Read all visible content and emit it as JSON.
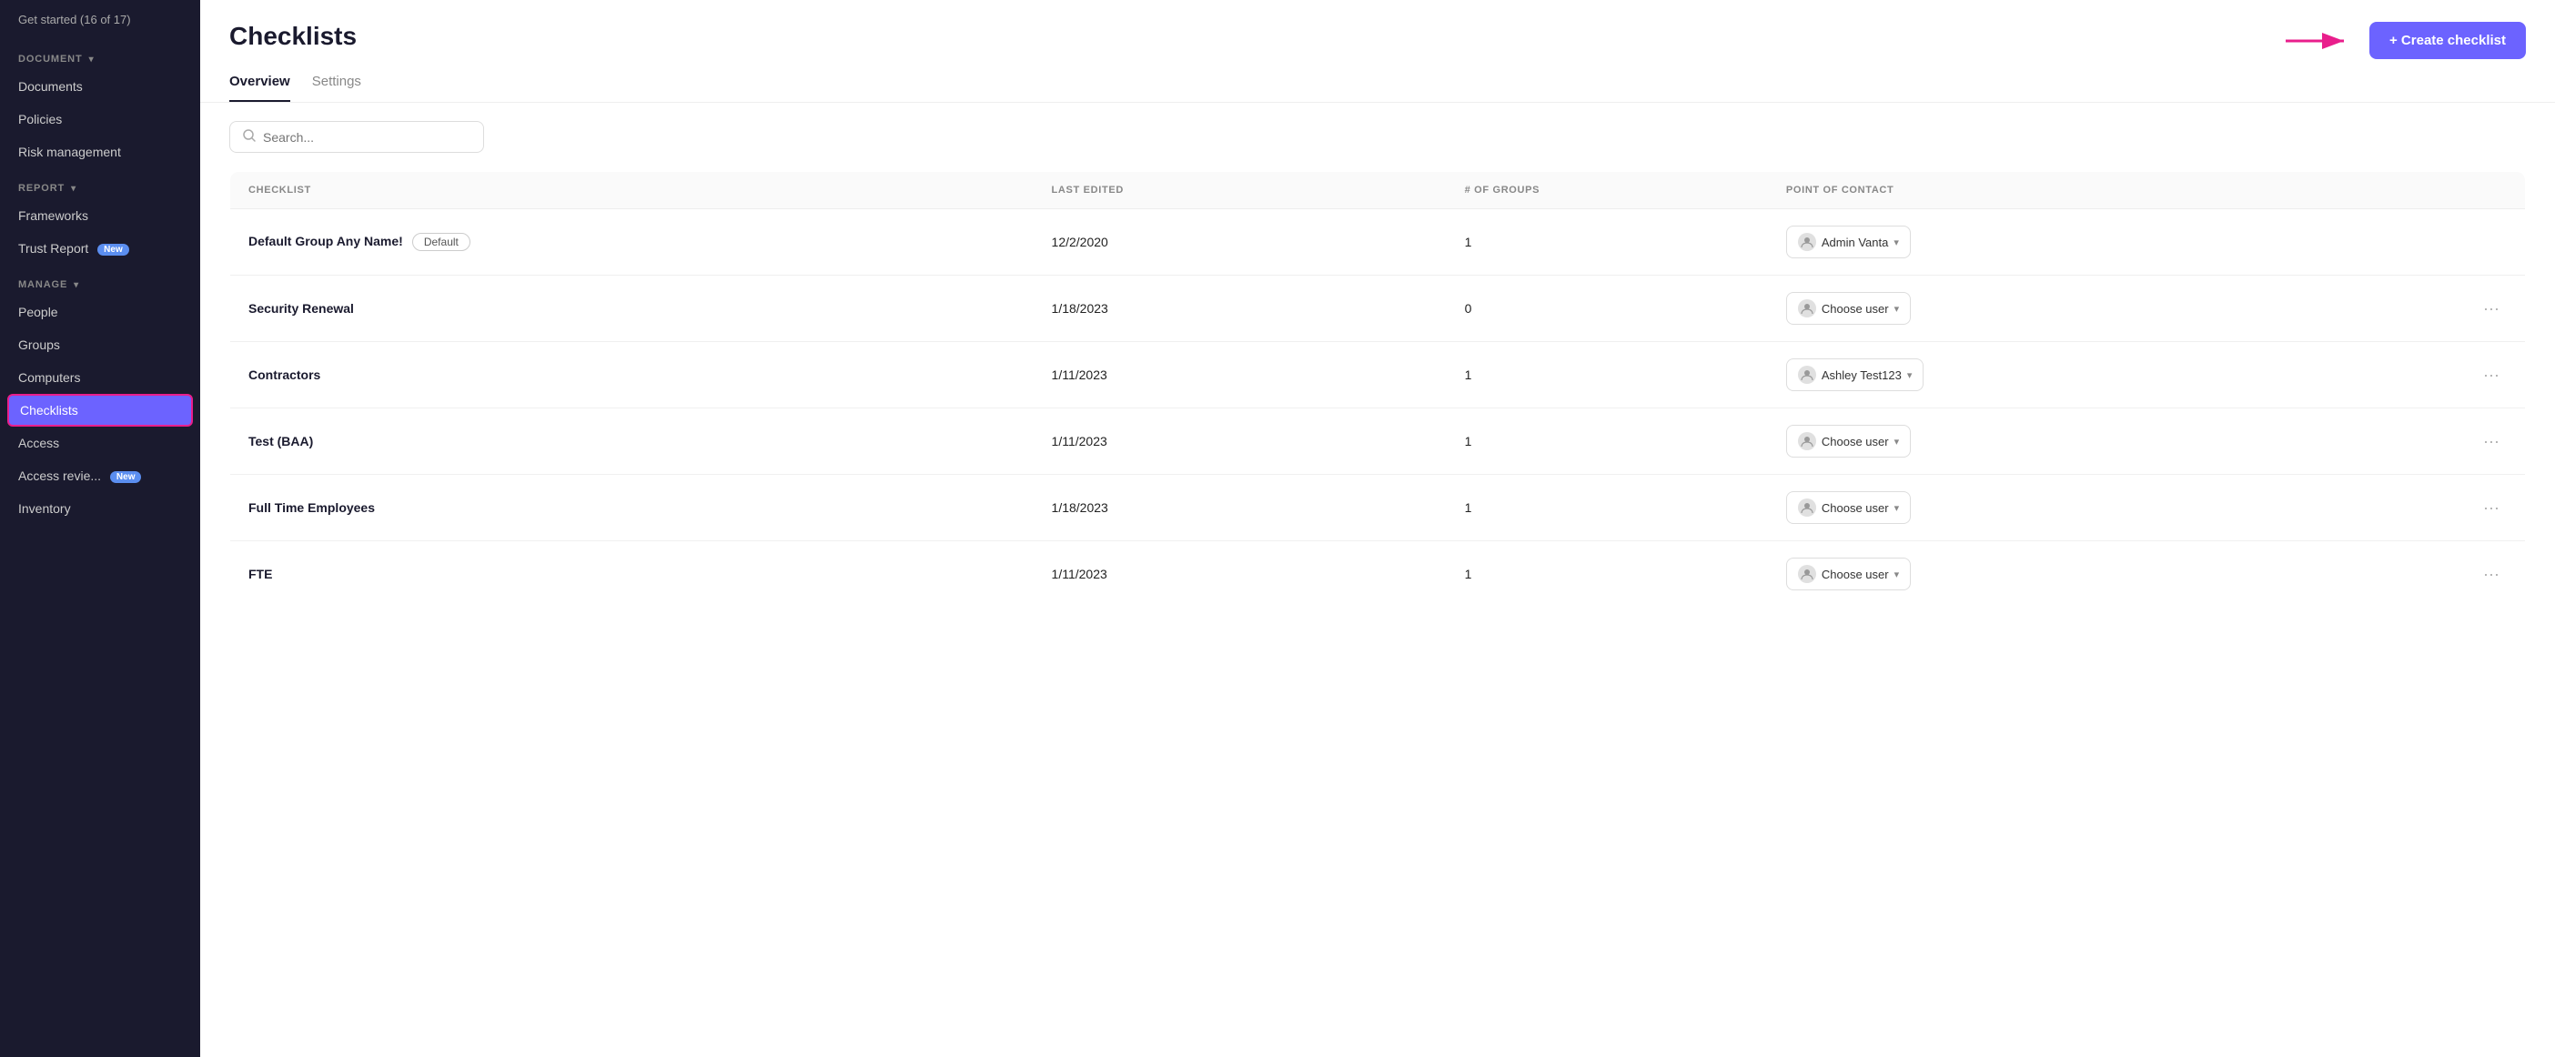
{
  "sidebar": {
    "top_item": "Get started (16 of 17)",
    "sections": [
      {
        "label": "DOCUMENT",
        "items": [
          {
            "id": "documents",
            "label": "Documents",
            "active": false
          },
          {
            "id": "policies",
            "label": "Policies",
            "active": false
          },
          {
            "id": "risk-management",
            "label": "Risk management",
            "active": false
          }
        ]
      },
      {
        "label": "REPORT",
        "items": [
          {
            "id": "frameworks",
            "label": "Frameworks",
            "active": false
          },
          {
            "id": "trust-report",
            "label": "Trust Report",
            "badge": "New",
            "active": false
          }
        ]
      },
      {
        "label": "MANAGE",
        "items": [
          {
            "id": "people",
            "label": "People",
            "active": false
          },
          {
            "id": "groups",
            "label": "Groups",
            "active": false
          },
          {
            "id": "computers",
            "label": "Computers",
            "active": false
          },
          {
            "id": "checklists",
            "label": "Checklists",
            "active": true
          },
          {
            "id": "access",
            "label": "Access",
            "active": false
          },
          {
            "id": "access-review",
            "label": "Access revie...",
            "badge": "New",
            "active": false
          },
          {
            "id": "inventory",
            "label": "Inventory",
            "active": false
          }
        ]
      }
    ]
  },
  "page": {
    "title": "Checklists",
    "tabs": [
      {
        "id": "overview",
        "label": "Overview",
        "active": true
      },
      {
        "id": "settings",
        "label": "Settings",
        "active": false
      }
    ],
    "create_button": "+ Create checklist",
    "search_placeholder": "Search..."
  },
  "table": {
    "columns": [
      {
        "id": "checklist",
        "label": "CHECKLIST"
      },
      {
        "id": "last-edited",
        "label": "LAST EDITED"
      },
      {
        "id": "num-groups",
        "label": "# OF GROUPS"
      },
      {
        "id": "point-of-contact",
        "label": "POINT OF CONTACT"
      }
    ],
    "rows": [
      {
        "id": 1,
        "name": "Default Group Any Name!",
        "is_default": true,
        "last_edited": "12/2/2020",
        "num_groups": "1",
        "contact": "Admin Vanta",
        "contact_type": "named",
        "has_more": false
      },
      {
        "id": 2,
        "name": "Security Renewal",
        "is_default": false,
        "last_edited": "1/18/2023",
        "num_groups": "0",
        "contact": "Choose user",
        "contact_type": "choose",
        "has_more": true
      },
      {
        "id": 3,
        "name": "Contractors",
        "is_default": false,
        "last_edited": "1/11/2023",
        "num_groups": "1",
        "contact": "Ashley Test123",
        "contact_type": "named",
        "has_more": true
      },
      {
        "id": 4,
        "name": "Test (BAA)",
        "is_default": false,
        "last_edited": "1/11/2023",
        "num_groups": "1",
        "contact": "Choose user",
        "contact_type": "choose",
        "has_more": true
      },
      {
        "id": 5,
        "name": "Full Time Employees",
        "is_default": false,
        "last_edited": "1/18/2023",
        "num_groups": "1",
        "contact": "Choose user",
        "contact_type": "choose",
        "has_more": true
      },
      {
        "id": 6,
        "name": "FTE",
        "is_default": false,
        "last_edited": "1/11/2023",
        "num_groups": "1",
        "contact": "Choose user",
        "contact_type": "choose",
        "has_more": true
      }
    ],
    "default_label": "Default",
    "more_icon": "⋯"
  }
}
